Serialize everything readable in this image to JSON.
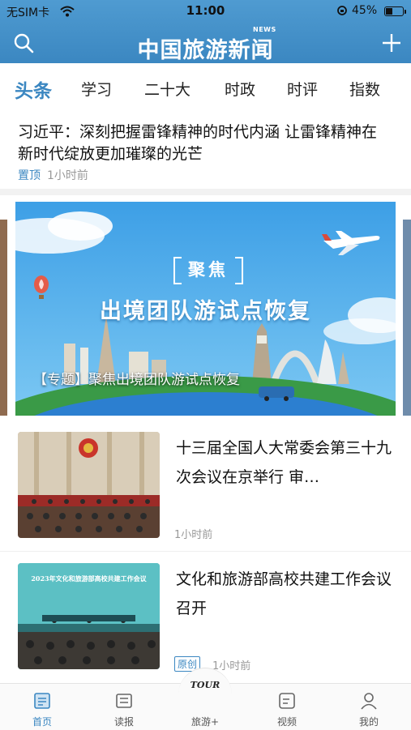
{
  "status_bar": {
    "carrier": "无SIM卡",
    "time": "11:00",
    "battery_pct": "45%",
    "battery_level": 0.45,
    "icons": [
      "wifi-icon",
      "rotation-lock-icon",
      "battery-icon"
    ]
  },
  "header": {
    "logo_text": "中国旅游新闻",
    "logo_tag": "NEWS",
    "icons": [
      "search-icon",
      "plus-icon"
    ],
    "bg_color": "#3b87c1"
  },
  "tabs": [
    {
      "label": "头条",
      "active": true
    },
    {
      "label": "学习"
    },
    {
      "label": "二十大"
    },
    {
      "label": "时政"
    },
    {
      "label": "时评"
    },
    {
      "label": "指数"
    }
  ],
  "headline": {
    "title": "习近平：深刻把握雷锋精神的时代内涵 让雷锋精神在新时代绽放更加璀璨的光芒",
    "tag": "置顶",
    "time": "1小时前"
  },
  "banner": {
    "kicker": "聚焦",
    "title": "出境团队游试点恢复",
    "caption": "【专题】聚焦出境团队游试点恢复"
  },
  "news": [
    {
      "title": "十三届全国人大常委会第三十九次会议在京举行 审…",
      "time": "1小时前"
    },
    {
      "title": "文化和旅游部高校共建工作会议召开",
      "tag": "原创",
      "time": "1小时前",
      "thumb_text": "2023年文化和旅游部高校共建工作会议"
    }
  ],
  "bottom_nav": [
    {
      "label": "首页",
      "icon": "home-news-icon",
      "active": true
    },
    {
      "label": "读报",
      "icon": "newspaper-icon"
    },
    {
      "label": "旅游+",
      "icon": "tour-logo-icon",
      "logo_text": "TOUR"
    },
    {
      "label": "视频",
      "icon": "video-icon"
    },
    {
      "label": "我的",
      "icon": "profile-icon"
    }
  ]
}
